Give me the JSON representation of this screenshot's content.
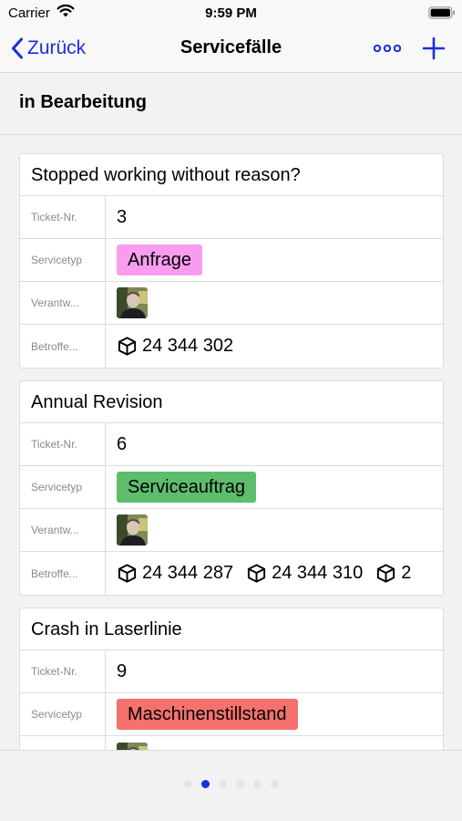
{
  "status_bar": {
    "carrier": "Carrier",
    "time": "9:59 PM"
  },
  "nav": {
    "back_label": "Zurück",
    "title": "Servicefälle"
  },
  "section": {
    "title": "in Bearbeitung"
  },
  "labels": {
    "ticket": "Ticket-Nr.",
    "servicetyp": "Servicetyp",
    "verantwortlich": "Verantw...",
    "betroffen": "Betroffe..."
  },
  "tickets": [
    {
      "title": "Stopped working without reason?",
      "number": "3",
      "service_type": "Anfrage",
      "service_color": "#f99cf0",
      "items": [
        "24 344 302"
      ]
    },
    {
      "title": "Annual Revision",
      "number": "6",
      "service_type": "Serviceauftrag",
      "service_color": "#5dbd6c",
      "items": [
        "24 344 287",
        "24 344 310",
        "2"
      ]
    },
    {
      "title": "Crash in Laserlinie",
      "number": "9",
      "service_type": "Maschinenstillstand",
      "service_color": "#f4716d",
      "items": []
    }
  ],
  "colors": {
    "accent": "#1a2ee0"
  },
  "pager": {
    "count": 6,
    "active_index": 1
  }
}
